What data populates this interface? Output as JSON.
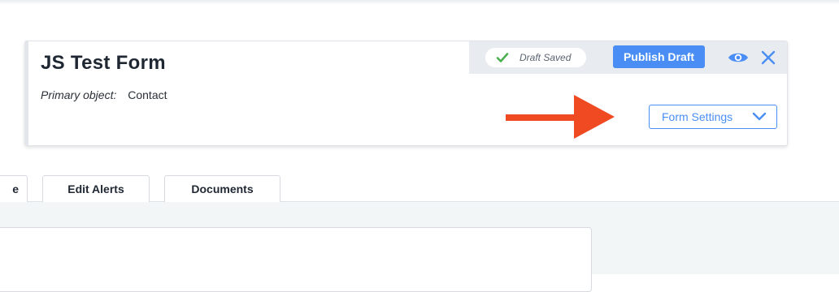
{
  "form": {
    "title": "JS Test Form",
    "primary_object_label": "Primary object:",
    "primary_object_value": "Contact"
  },
  "status": {
    "draft_label": "Draft Saved",
    "publish_label": "Publish Draft"
  },
  "settings": {
    "label": "Form Settings"
  },
  "tabs": [
    {
      "label": "e"
    },
    {
      "label": "Edit Alerts"
    },
    {
      "label": "Documents"
    }
  ],
  "colors": {
    "accent": "#4a8ef5",
    "check": "#4caf50",
    "annotation_arrow": "#f04a23"
  },
  "icons": [
    "check-icon",
    "eye-icon",
    "close-icon",
    "chevron-down-icon",
    "arrow-annotation"
  ]
}
